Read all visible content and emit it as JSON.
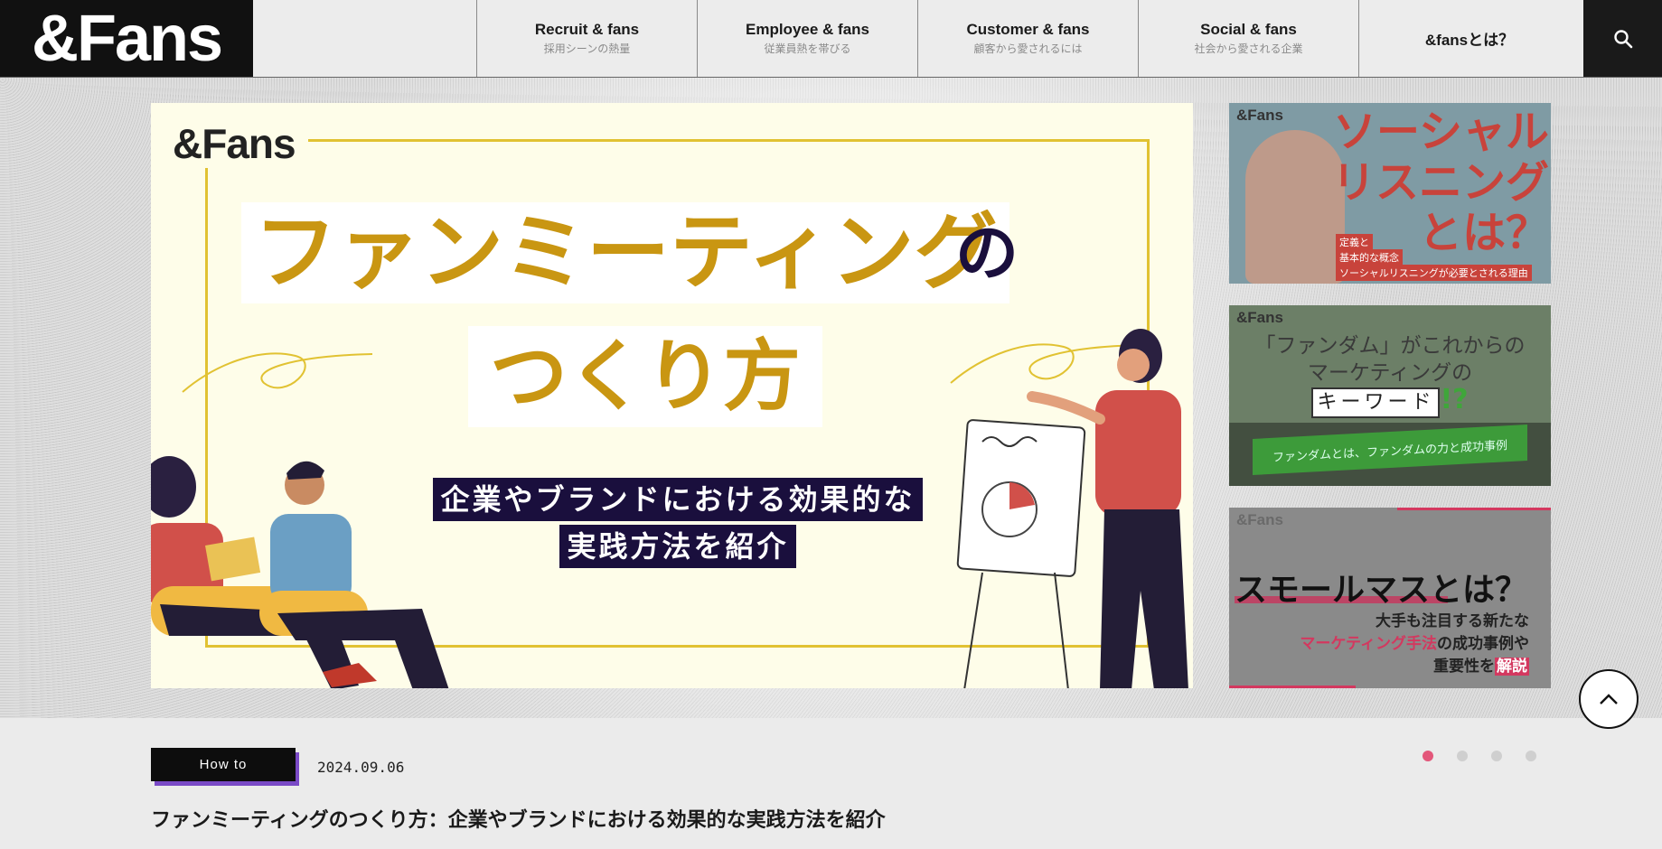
{
  "header": {
    "logo": "&Fans",
    "nav": [
      {
        "title": "Recruit & fans",
        "sub": "採用シーンの熱量"
      },
      {
        "title": "Employee & fans",
        "sub": "従業員熱を帯びる"
      },
      {
        "title": "Customer & fans",
        "sub": "顧客から愛されるには"
      },
      {
        "title": "Social & fans",
        "sub": "社会から愛される企業"
      },
      {
        "title": "&fansとは？",
        "sub": ""
      }
    ],
    "search_icon": "search-icon"
  },
  "hero": {
    "logo": "&Fans",
    "title_line1": "ファンミーティング",
    "title_no": "の",
    "title_line2": "つくり方",
    "subtitle_line1": "企業やブランドにおける効果的な",
    "subtitle_line2": "実践方法を紹介",
    "accent_color": "#c99612",
    "navy_color": "#1a0f3d"
  },
  "side_cards": {
    "card1": {
      "logo": "&Fans",
      "title_line1": "ソーシャル",
      "title_line2": "リスニング",
      "title_line3": "とは？",
      "tag1": "定義と",
      "tag2": "基本的な概念",
      "tag3": "ソーシャルリスニングが必要とされる理由"
    },
    "card2": {
      "logo": "&Fans",
      "line1": "「ファンダム」がこれからの",
      "line2": "マーケティングの",
      "keyword": "キーワード",
      "mark": "!?",
      "ribbon": "ファンダムとは、ファンダムの力と成功事例"
    },
    "card3": {
      "logo": "&Fans",
      "title": "スモールマスとは？",
      "line1": "大手も注目する新たな",
      "line2_pink": "マーケティング手法",
      "line2_rest": "の成功事例や",
      "line3_rest": "重要性を",
      "line3_box": "解説"
    }
  },
  "article": {
    "tag": "How to",
    "date": "2024.09.06",
    "title": "ファンミーティングのつくり方：企業やブランドにおける効果的な実践方法を紹介"
  },
  "carousel": {
    "total": 4,
    "active": 1
  },
  "colors": {
    "dot_active": "#e3577a",
    "tag_shadow": "#7a4ac6",
    "pink": "#d3385f"
  }
}
